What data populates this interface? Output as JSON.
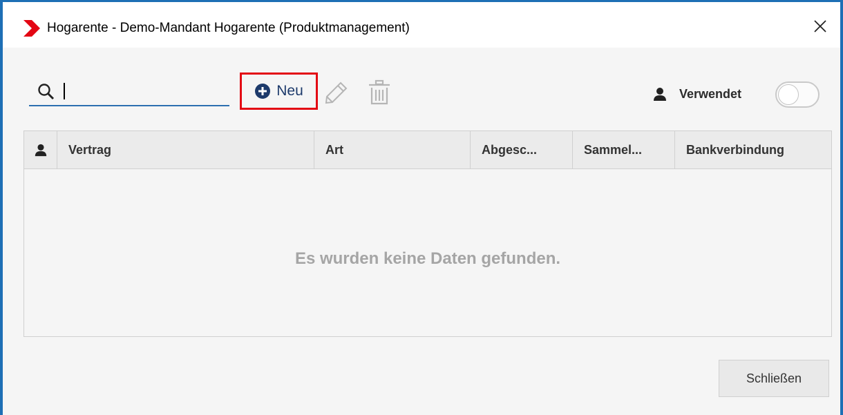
{
  "window": {
    "title": "Hogarente - Demo-Mandant Hogarente (Produktmanagement)"
  },
  "toolbar": {
    "search_value": "",
    "new_label": "Neu",
    "used_label": "Verwendet",
    "used_toggle_on": false
  },
  "table": {
    "columns": [
      "",
      "Vertrag",
      "Art",
      "Abgesc...",
      "Sammel...",
      "Bankverbindung"
    ],
    "rows": [],
    "empty_message": "Es wurden keine Daten gefunden."
  },
  "footer": {
    "close_label": "Schließen"
  },
  "colors": {
    "accent": "#1e6fb5",
    "highlight": "#e30613",
    "brand": "#e30613"
  }
}
